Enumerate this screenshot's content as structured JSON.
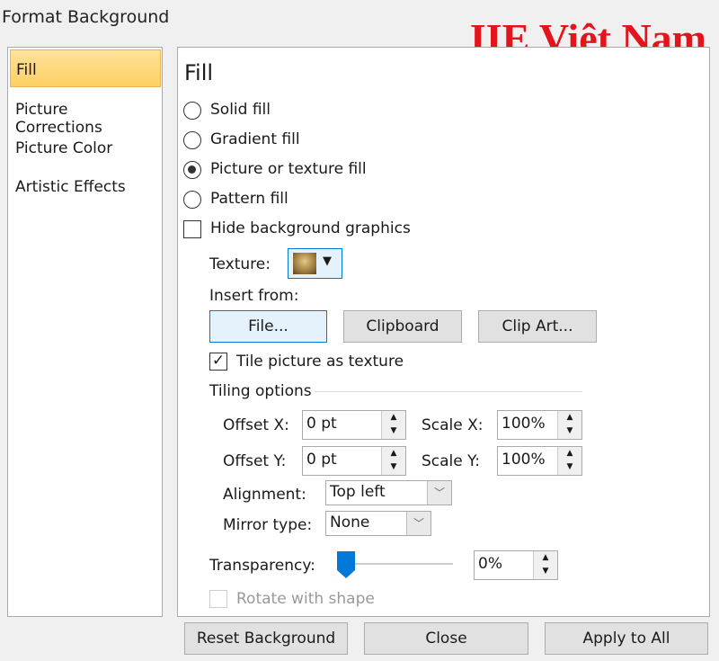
{
  "window": {
    "title": "Format Background",
    "watermark": "IIE Việt Nam"
  },
  "sidebar": {
    "items": [
      {
        "label": "Fill",
        "selected": true
      },
      {
        "label": "Picture Corrections"
      },
      {
        "label": "Picture Color"
      },
      {
        "label": "Artistic Effects"
      }
    ]
  },
  "fill": {
    "heading": "Fill",
    "options": [
      {
        "label": "Solid fill",
        "checked": false
      },
      {
        "label": "Gradient fill",
        "checked": false
      },
      {
        "label": "Picture or texture fill",
        "checked": true
      },
      {
        "label": "Pattern fill",
        "checked": false
      }
    ],
    "hide_bg": {
      "label": "Hide background graphics",
      "checked": false
    },
    "texture_label": "Texture:",
    "insert_from": "Insert from:",
    "buttons": {
      "file": "File...",
      "clipboard": "Clipboard",
      "clipart": "Clip Art..."
    },
    "tile": {
      "label": "Tile picture as texture",
      "checked": true
    },
    "tiling_options": "Tiling options",
    "offset_x": {
      "label": "Offset X:",
      "value": "0 pt"
    },
    "offset_y": {
      "label": "Offset Y:",
      "value": "0 pt"
    },
    "scale_x": {
      "label": "Scale X:",
      "value": "100%"
    },
    "scale_y": {
      "label": "Scale Y:",
      "value": "100%"
    },
    "alignment": {
      "label": "Alignment:",
      "value": "Top left"
    },
    "mirror": {
      "label": "Mirror type:",
      "value": "None"
    },
    "transparency": {
      "label": "Transparency:",
      "value": "0%",
      "percent": 0
    },
    "rotate": {
      "label": "Rotate with shape",
      "checked": false,
      "disabled": true
    }
  },
  "footer": {
    "reset": "Reset Background",
    "close": "Close",
    "apply": "Apply to All"
  },
  "colors": {
    "accent": "#0078d7",
    "selected": "#fccf63",
    "watermark": "#e3141b"
  }
}
